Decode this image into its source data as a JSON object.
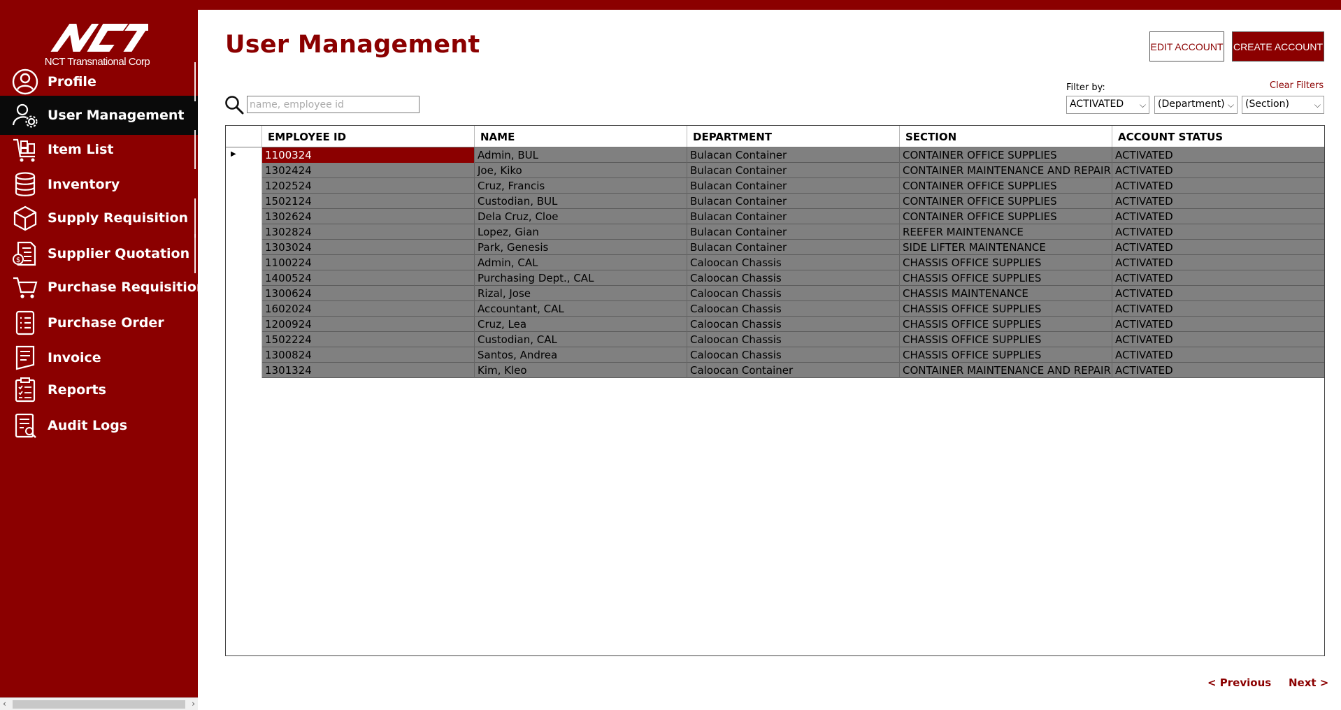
{
  "brand": {
    "company": "NCT Transnational Corp",
    "logo_mark": "NCT"
  },
  "colors": {
    "accent": "#8b0000",
    "active_nav": "#0a0a0a",
    "row_fill": "#808080"
  },
  "sidebar": {
    "items": [
      {
        "label": "Profile",
        "icon": "profile-icon"
      },
      {
        "label": "User Management",
        "icon": "user-gear-icon",
        "active": true
      },
      {
        "label": "Item List",
        "icon": "cart-boxes-icon"
      },
      {
        "label": "Inventory",
        "icon": "database-icon"
      },
      {
        "label": "Supply Requisition",
        "icon": "box-icon"
      },
      {
        "label": "Supplier Quotation",
        "icon": "quotation-icon"
      },
      {
        "label": "Purchase Requisition",
        "icon": "cart-icon"
      },
      {
        "label": "Purchase Order",
        "icon": "list-icon"
      },
      {
        "label": "Invoice",
        "icon": "invoice-icon"
      },
      {
        "label": "Reports",
        "icon": "clipboard-icon"
      },
      {
        "label": "Audit Logs",
        "icon": "audit-icon"
      }
    ]
  },
  "header": {
    "title": "User Management",
    "edit_button": "EDIT ACCOUNT",
    "create_button": "CREATE ACCOUNT"
  },
  "search": {
    "placeholder": "name, employee id",
    "value": ""
  },
  "filters": {
    "label": "Filter by:",
    "clear": "Clear Filters",
    "status": "ACTIVATED",
    "department": "(Department)",
    "section": "(Section)"
  },
  "table": {
    "columns": [
      "EMPLOYEE ID",
      "NAME",
      "DEPARTMENT",
      "SECTION",
      "ACCOUNT STATUS"
    ],
    "rows": [
      [
        "1100324",
        "Admin, BUL",
        "Bulacan Container",
        "CONTAINER OFFICE SUPPLIES",
        "ACTIVATED"
      ],
      [
        "1302424",
        "Joe, Kiko",
        "Bulacan Container",
        "CONTAINER MAINTENANCE AND REPAIR",
        "ACTIVATED"
      ],
      [
        "1202524",
        "Cruz, Francis",
        "Bulacan Container",
        "CONTAINER OFFICE SUPPLIES",
        "ACTIVATED"
      ],
      [
        "1502124",
        "Custodian, BUL",
        "Bulacan Container",
        "CONTAINER OFFICE SUPPLIES",
        "ACTIVATED"
      ],
      [
        "1302624",
        "Dela Cruz, Cloe",
        "Bulacan Container",
        "CONTAINER OFFICE SUPPLIES",
        "ACTIVATED"
      ],
      [
        "1302824",
        "Lopez, Gian",
        "Bulacan Container",
        "REEFER MAINTENANCE",
        "ACTIVATED"
      ],
      [
        "1303024",
        "Park, Genesis",
        "Bulacan Container",
        "SIDE LIFTER MAINTENANCE",
        "ACTIVATED"
      ],
      [
        "1100224",
        "Admin, CAL",
        "Caloocan Chassis",
        "CHASSIS OFFICE SUPPLIES",
        "ACTIVATED"
      ],
      [
        "1400524",
        "Purchasing Dept., CAL",
        "Caloocan Chassis",
        "CHASSIS OFFICE SUPPLIES",
        "ACTIVATED"
      ],
      [
        "1300624",
        "Rizal, Jose",
        "Caloocan Chassis",
        "CHASSIS MAINTENANCE",
        "ACTIVATED"
      ],
      [
        "1602024",
        "Accountant, CAL",
        "Caloocan Chassis",
        "CHASSIS OFFICE SUPPLIES",
        "ACTIVATED"
      ],
      [
        "1200924",
        "Cruz, Lea",
        "Caloocan Chassis",
        "CHASSIS OFFICE SUPPLIES",
        "ACTIVATED"
      ],
      [
        "1502224",
        "Custodian, CAL",
        "Caloocan Chassis",
        "CHASSIS OFFICE SUPPLIES",
        "ACTIVATED"
      ],
      [
        "1300824",
        "Santos, Andrea",
        "Caloocan Chassis",
        "CHASSIS OFFICE SUPPLIES",
        "ACTIVATED"
      ],
      [
        "1301324",
        "Kim, Kleo",
        "Caloocan Container",
        "CONTAINER MAINTENANCE AND REPAIR",
        "ACTIVATED"
      ]
    ]
  },
  "pager": {
    "prev": "< Previous",
    "next": "Next >"
  }
}
